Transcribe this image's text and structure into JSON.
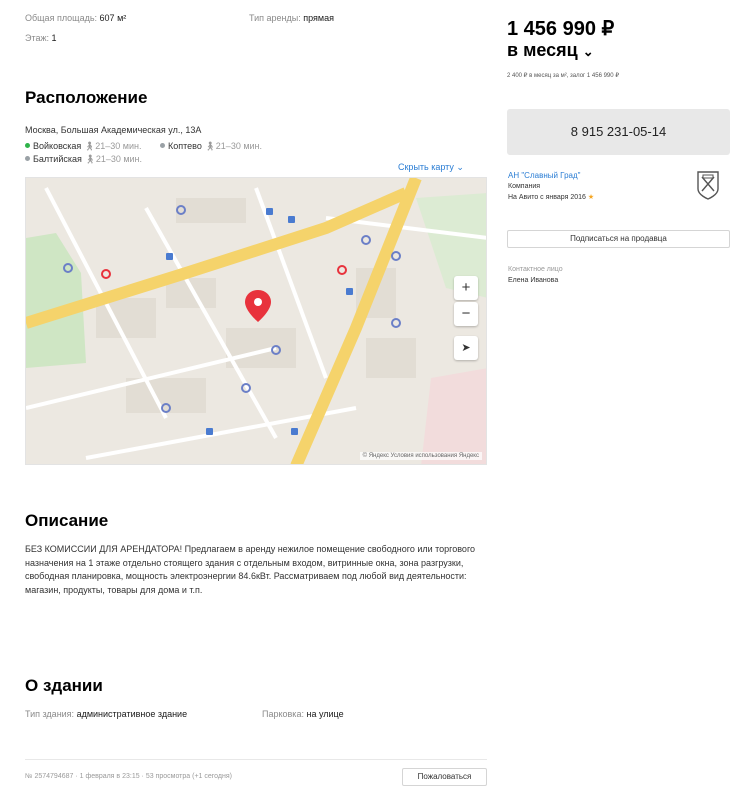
{
  "params": {
    "area_label": "Общая площадь:",
    "area_value": "607 м²",
    "floor_label": "Этаж:",
    "floor_value": "1",
    "rent_type_label": "Тип аренды:",
    "rent_type_value": "прямая"
  },
  "location": {
    "heading": "Расположение",
    "address": "Москва, Большая Академическая ул., 13А",
    "metro": [
      {
        "name": "Войковская",
        "walk": "21–30 мин.",
        "color": "#2fb34a"
      },
      {
        "name": "Коптево",
        "walk": "21–30 мин.",
        "color": "#9aa1a6"
      },
      {
        "name": "Балтийская",
        "walk": "21–30 мин.",
        "color": "#9aa1a6"
      }
    ],
    "hide_map": "Скрыть карту",
    "map_credit": "© Яндекс  Условия использования  Яндекс"
  },
  "description": {
    "heading": "Описание",
    "text": "БЕЗ КОМИССИИ ДЛЯ АРЕНДАТОРА! Предлагаем в аренду нежилое помещение свободного или торгового назначения на 1 этаже отдельно стоящего здания с отдельным входом, витринные окна, зона разгрузки, свободная планировка, мощность электроэнергии 84.6кВт. Рассматриваем под любой вид деятельности: магазин, продукты, товары для дома и т.п."
  },
  "building": {
    "heading": "О здании",
    "type_label": "Тип здания:",
    "type_value": "административное здание",
    "parking_label": "Парковка:",
    "parking_value": "на улице"
  },
  "footer": {
    "meta": "№ 2574794687 · 1 февраля в 23:15 · 53 просмотра (+1 сегодня)",
    "complain": "Пожаловаться"
  },
  "sidebar": {
    "price": "1 456 990 ₽",
    "period": "в месяц",
    "price_note": "2 400 ₽ в месяц за м², залог 1 456 990 ₽",
    "phone": "8 915 231-05-14",
    "seller_name": "АН \"Славный Град\"",
    "seller_type": "Компания",
    "seller_since": "На Авито с января 2016",
    "subscribe": "Подписаться на продавца",
    "contact_label": "Контактное лицо",
    "contact_name": "Елена Иванова"
  },
  "colors": {
    "link": "#2a7dd4",
    "pin": "#e8323c",
    "metro_active": "#2fb34a"
  }
}
